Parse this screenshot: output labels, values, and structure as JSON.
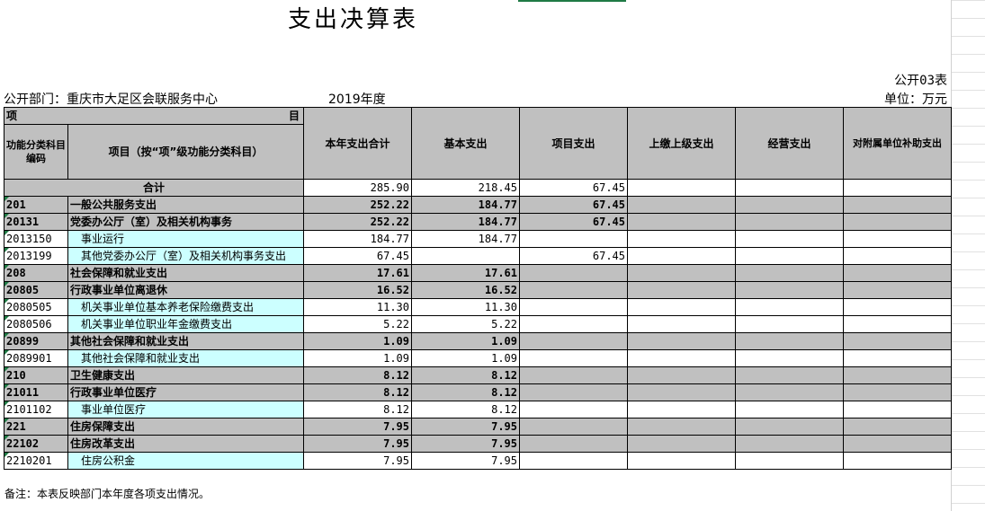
{
  "title": "支出决算表",
  "form_no": "公开03表",
  "department": "公开部门：重庆市大足区会联服务中心",
  "year": "2019年度",
  "unit": "单位：万元",
  "headers": {
    "item": "项",
    "item_end": "目",
    "code": "功能分类科目编码",
    "name": "项目（按“项”级功能分类科目）",
    "total": "本年支出合计",
    "basic": "基本支出",
    "project": "项目支出",
    "superior": "上缴上级支出",
    "operating": "经营支出",
    "subsidy": "对附属单位补助支出"
  },
  "total_label": "合计",
  "total": {
    "total": "285.90",
    "basic": "218.45",
    "project": "67.45"
  },
  "rows": [
    {
      "code": "201",
      "name": "一般公共服务支出",
      "total": "252.22",
      "basic": "184.77",
      "project": "67.45",
      "level": "bold"
    },
    {
      "code": "20131",
      "name": "党委办公厅（室）及相关机构事务",
      "total": "252.22",
      "basic": "184.77",
      "project": "67.45",
      "level": "bold"
    },
    {
      "code": "2013150",
      "name": "事业运行",
      "total": "184.77",
      "basic": "184.77",
      "project": "",
      "level": "detail"
    },
    {
      "code": "2013199",
      "name": "其他党委办公厅（室）及相关机构事务支出",
      "total": "67.45",
      "basic": "",
      "project": "67.45",
      "level": "detail"
    },
    {
      "code": "208",
      "name": "社会保障和就业支出",
      "total": "17.61",
      "basic": "17.61",
      "project": "",
      "level": "bold"
    },
    {
      "code": "20805",
      "name": "行政事业单位离退休",
      "total": "16.52",
      "basic": "16.52",
      "project": "",
      "level": "bold"
    },
    {
      "code": "2080505",
      "name": "机关事业单位基本养老保险缴费支出",
      "total": "11.30",
      "basic": "11.30",
      "project": "",
      "level": "detail"
    },
    {
      "code": "2080506",
      "name": "机关事业单位职业年金缴费支出",
      "total": "5.22",
      "basic": "5.22",
      "project": "",
      "level": "detail"
    },
    {
      "code": "20899",
      "name": "其他社会保障和就业支出",
      "total": "1.09",
      "basic": "1.09",
      "project": "",
      "level": "bold"
    },
    {
      "code": "2089901",
      "name": "其他社会保障和就业支出",
      "total": "1.09",
      "basic": "1.09",
      "project": "",
      "level": "detail"
    },
    {
      "code": "210",
      "name": "卫生健康支出",
      "total": "8.12",
      "basic": "8.12",
      "project": "",
      "level": "bold"
    },
    {
      "code": "21011",
      "name": "行政事业单位医疗",
      "total": "8.12",
      "basic": "8.12",
      "project": "",
      "level": "bold"
    },
    {
      "code": "2101102",
      "name": "事业单位医疗",
      "total": "8.12",
      "basic": "8.12",
      "project": "",
      "level": "detail"
    },
    {
      "code": "221",
      "name": "住房保障支出",
      "total": "7.95",
      "basic": "7.95",
      "project": "",
      "level": "bold"
    },
    {
      "code": "22102",
      "name": "住房改革支出",
      "total": "7.95",
      "basic": "7.95",
      "project": "",
      "level": "bold"
    },
    {
      "code": "2210201",
      "name": "住房公积金",
      "total": "7.95",
      "basic": "7.95",
      "project": "",
      "level": "detail"
    }
  ],
  "note": "备注：本表反映部门本年度各项支出情况。"
}
